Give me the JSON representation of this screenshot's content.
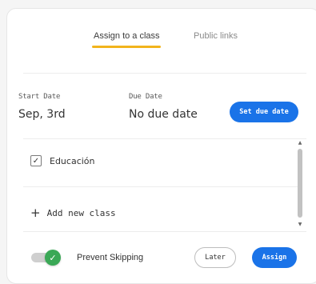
{
  "tabs": {
    "assign_label": "Assign to a class",
    "public_label": "Public links"
  },
  "dates": {
    "start_label": "Start Date",
    "start_value": "Sep, 3rd",
    "due_label": "Due Date",
    "due_value": "No due date",
    "set_due_button": "Set due date"
  },
  "classes": [
    {
      "label": "Educación",
      "checked": true,
      "check_glyph": "✓"
    }
  ],
  "add_class_label": "Add new class",
  "add_class_icon": "+",
  "footer": {
    "prevent_skipping_label": "Prevent Skipping",
    "prevent_skipping_on": true,
    "toggle_check": "✓",
    "later_button": "Later",
    "assign_button": "Assign"
  },
  "scroll": {
    "up_arrow": "▲",
    "down_arrow": "▼"
  },
  "colors": {
    "accent_tab": "#f2b41c",
    "primary_button": "#1a73e8",
    "toggle_on": "#3aa856"
  }
}
